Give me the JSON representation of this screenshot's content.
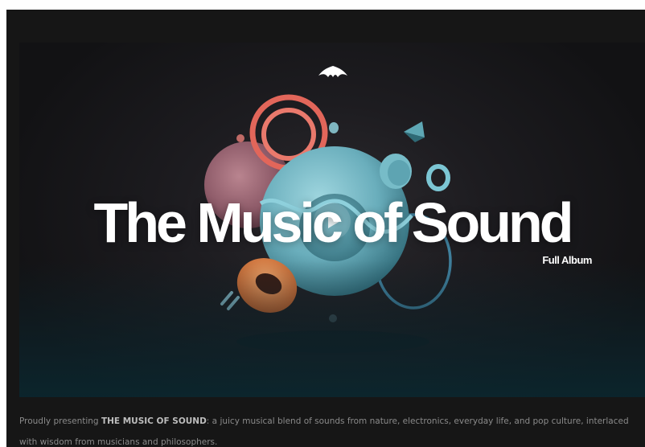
{
  "hero": {
    "title": "The Music of Sound",
    "subtitle": "Full Album"
  },
  "icons": {
    "logo": "winged-logo-icon",
    "play": "play-icon"
  },
  "description": {
    "intro": "Proudly presenting ",
    "highlight": "THE MUSIC OF SOUND",
    "body": ": a juicy musical blend of sounds from nature, electronics, everyday life, and pop culture, interlaced with wisdom from musicians and philosophers."
  },
  "colors": {
    "page_background": "#161616",
    "accent_teal": "#6fb6c4",
    "accent_coral": "#e2665a",
    "accent_orange": "#e8843c",
    "text_muted": "#8a8a8a"
  }
}
